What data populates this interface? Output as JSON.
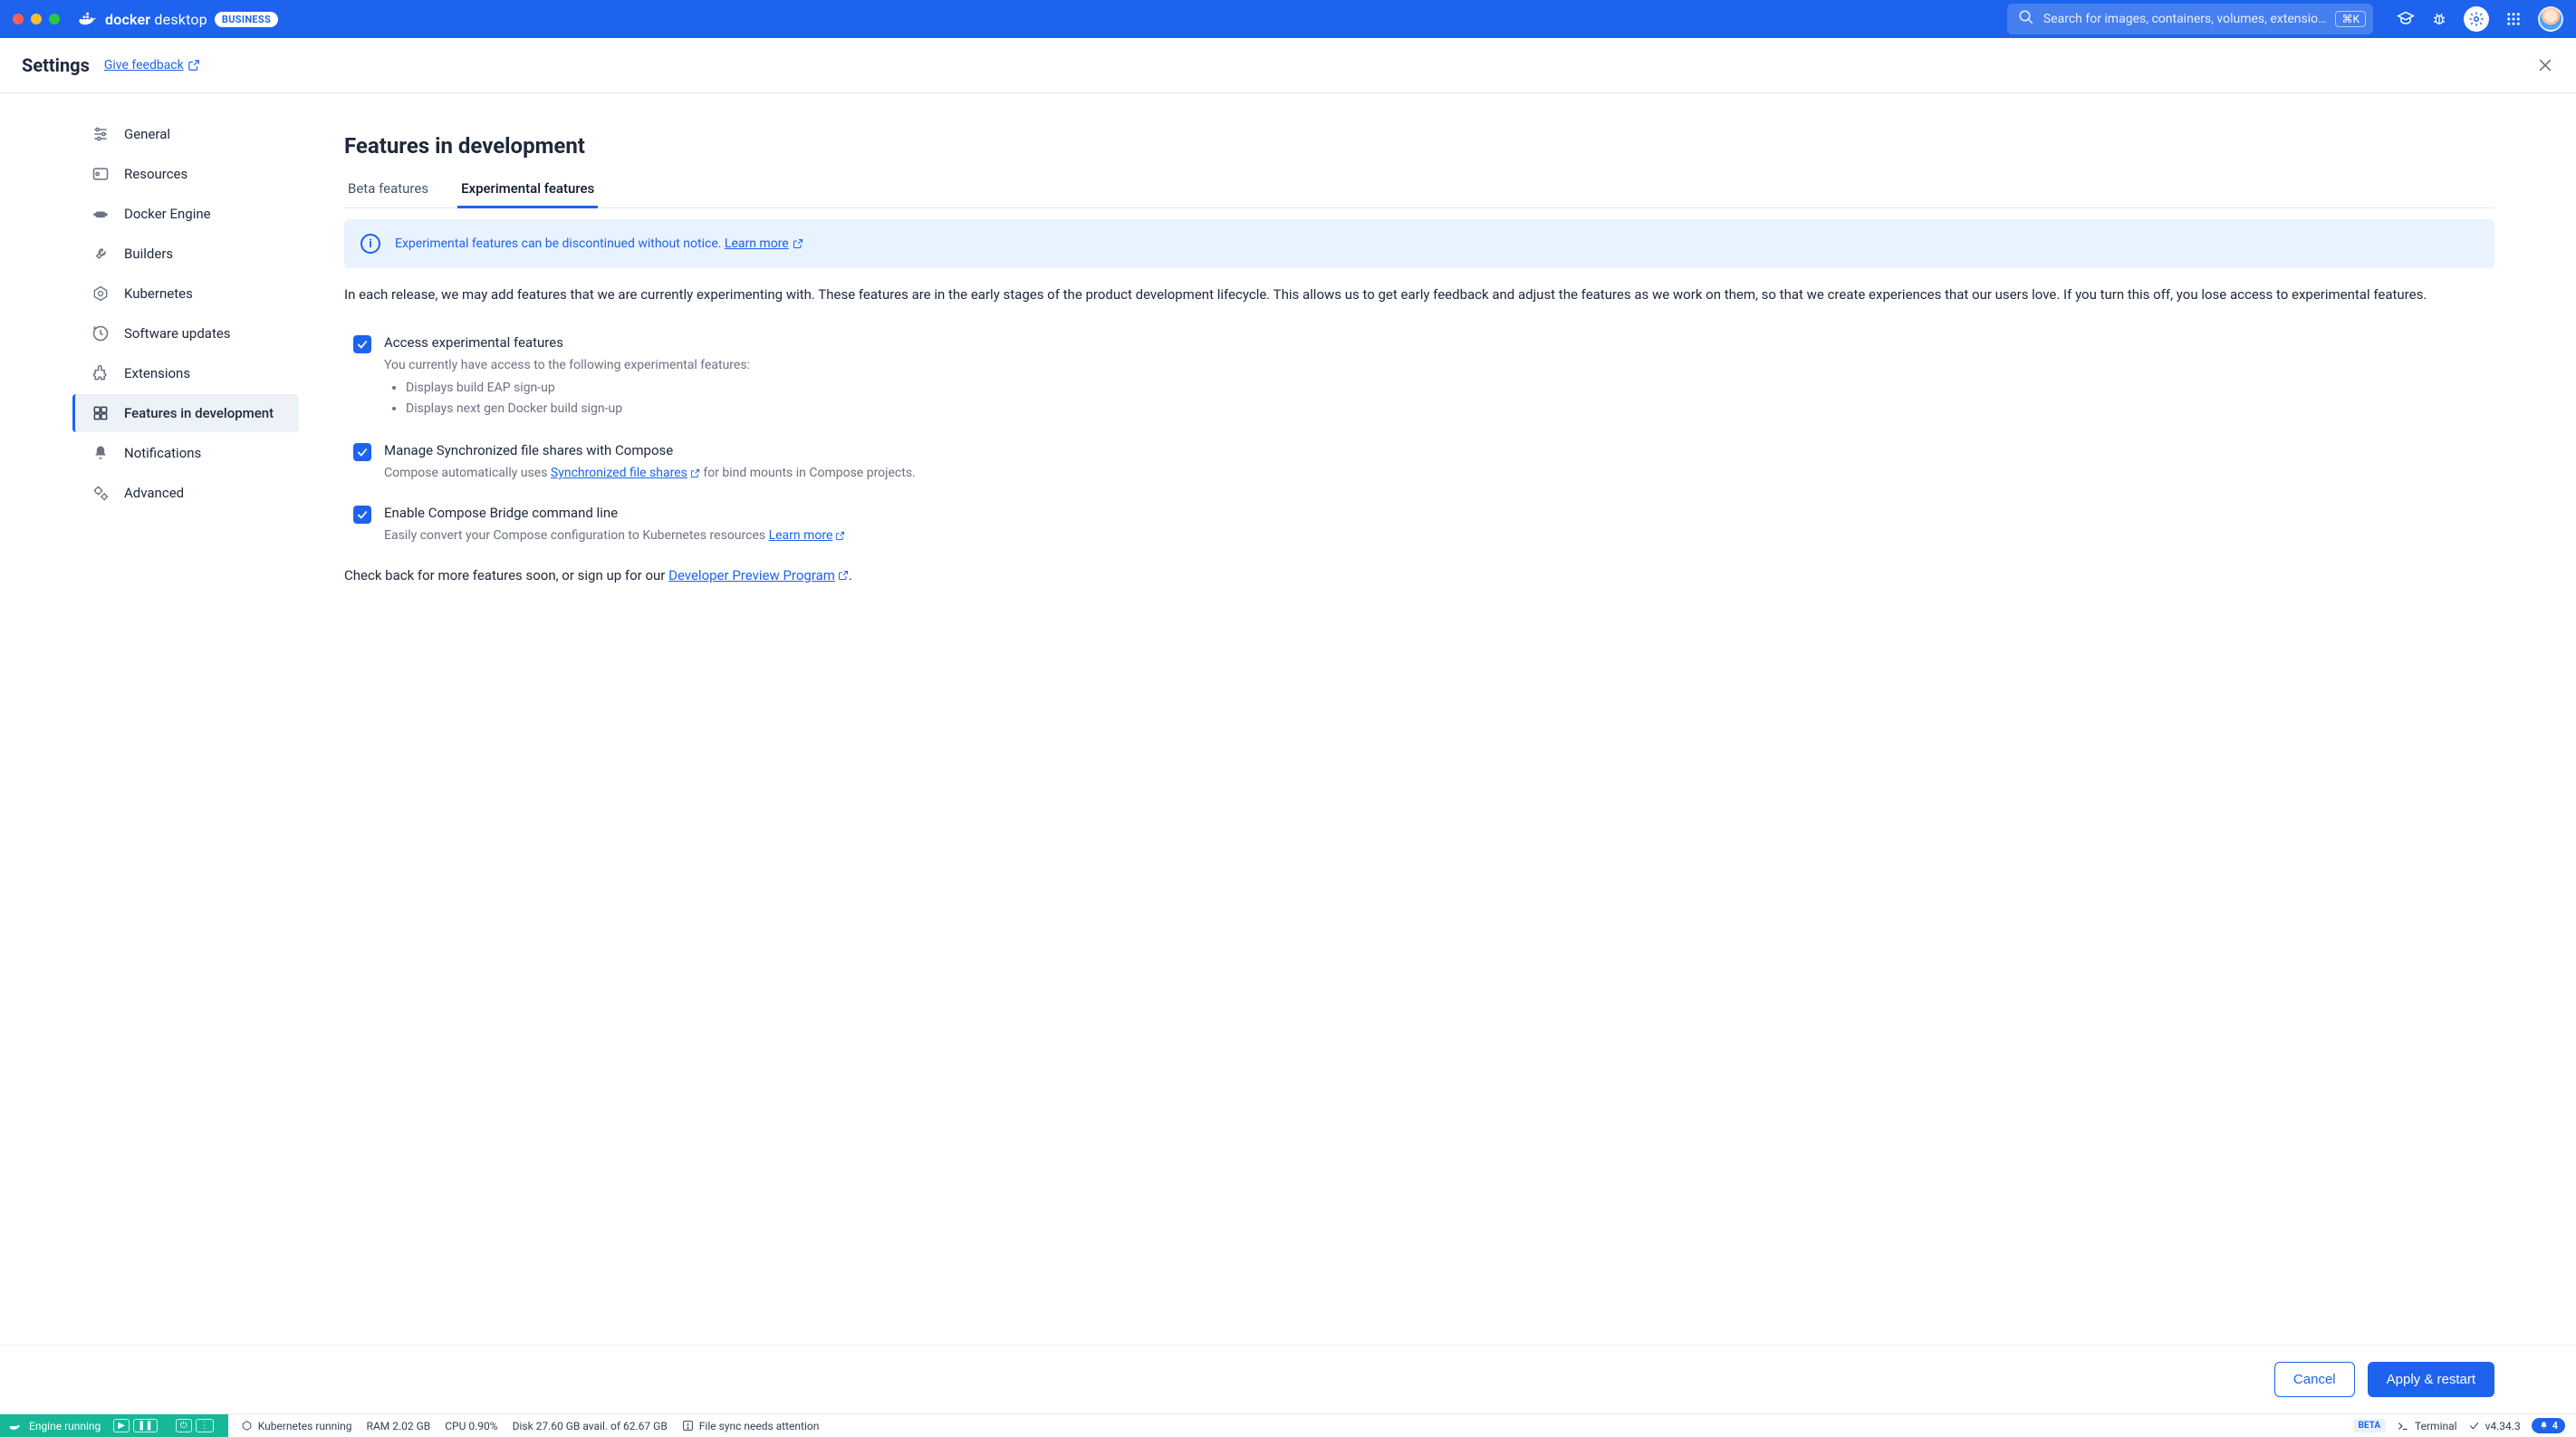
{
  "titlebar": {
    "brand_bold": "docker",
    "brand_light": " desktop",
    "business_badge": "BUSINESS",
    "search_placeholder": "Search for images, containers, volumes, extensio…",
    "search_shortcut": "⌘K"
  },
  "header": {
    "title": "Settings",
    "feedback": "Give feedback"
  },
  "sidebar": {
    "items": [
      {
        "label": "General"
      },
      {
        "label": "Resources"
      },
      {
        "label": "Docker Engine"
      },
      {
        "label": "Builders"
      },
      {
        "label": "Kubernetes"
      },
      {
        "label": "Software updates"
      },
      {
        "label": "Extensions"
      },
      {
        "label": "Features in development"
      },
      {
        "label": "Notifications"
      },
      {
        "label": "Advanced"
      }
    ]
  },
  "page": {
    "title": "Features in development",
    "tabs": {
      "beta": "Beta features",
      "experimental": "Experimental features"
    },
    "banner_text": "Experimental features can be discontinued without notice. ",
    "banner_link": "Learn more",
    "intro": "In each release, we may add features that we are currently experimenting with. These features are in the early stages of the product development lifecycle. This allows us to get early feedback and adjust the features as we work on them, so that we create experiences that our users love. If you turn this off, you lose access to experimental features.",
    "features": [
      {
        "title": "Access experimental features",
        "desc_lead": "You currently have access to the following experimental features:",
        "bullets": [
          "Displays build EAP sign-up",
          "Displays next gen Docker build sign-up"
        ]
      },
      {
        "title": "Manage Synchronized file shares with Compose",
        "desc_pre": "Compose automatically uses ",
        "desc_link": "Synchronized file shares",
        "desc_post": " for bind mounts in Compose projects."
      },
      {
        "title": "Enable Compose Bridge command line",
        "desc_pre": "Easily convert your Compose configuration to Kubernetes resources ",
        "desc_link": "Learn more"
      }
    ],
    "closing_pre": "Check back for more features soon, or sign up for our ",
    "closing_link": "Developer Preview Program",
    "closing_post": "."
  },
  "actions": {
    "cancel": "Cancel",
    "apply": "Apply & restart"
  },
  "status": {
    "engine": "Engine running",
    "k8s": "Kubernetes running",
    "ram": "RAM 2.02 GB",
    "cpu": "CPU 0.90%",
    "disk": "Disk 27.60 GB avail. of 62.67 GB",
    "filesync": "File sync needs attention",
    "beta": "BETA",
    "terminal": "Terminal",
    "version": "v4.34.3",
    "notif_count": "4"
  }
}
